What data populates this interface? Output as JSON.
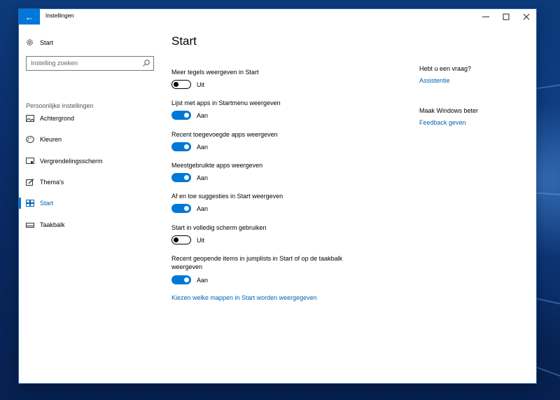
{
  "window": {
    "title": "Instellingen",
    "minimize_glyph": "—",
    "maximize_glyph": "☐",
    "close_glyph": "✕",
    "back_glyph": "←"
  },
  "sidebar": {
    "home_label": "Start",
    "search_placeholder": "Instelling zoeken",
    "section_label": "Persoonlijke instellingen",
    "items": [
      {
        "label": "Achtergrond",
        "icon": "picture-icon",
        "active": false
      },
      {
        "label": "Kleuren",
        "icon": "palette-icon",
        "active": false
      },
      {
        "label": "Vergrendelingsscherm",
        "icon": "lock-screen-icon",
        "active": false
      },
      {
        "label": "Thema's",
        "icon": "brush-icon",
        "active": false
      },
      {
        "label": "Start",
        "icon": "start-tiles-icon",
        "active": true
      },
      {
        "label": "Taakbalk",
        "icon": "taskbar-icon",
        "active": false
      }
    ]
  },
  "main": {
    "title": "Start",
    "settings": [
      {
        "label": "Meer tegels weergeven in Start",
        "on": false,
        "state": "Uit"
      },
      {
        "label": "Lijst met apps in Startmenu weergeven",
        "on": true,
        "state": "Aan"
      },
      {
        "label": "Recent toegevoegde apps weergeven",
        "on": true,
        "state": "Aan"
      },
      {
        "label": "Meestgebruikte apps weergeven",
        "on": true,
        "state": "Aan"
      },
      {
        "label": "Af en toe suggesties in Start weergeven",
        "on": true,
        "state": "Aan"
      },
      {
        "label": "Start in volledig scherm gebruiken",
        "on": false,
        "state": "Uit"
      },
      {
        "label": "Recent geopende items in jumplists in Start of op de taakbalk weergeven",
        "on": true,
        "state": "Aan"
      }
    ],
    "folders_link": "Kiezen welke mappen in Start worden weergegeven"
  },
  "aside": {
    "question_heading": "Hebt u een vraag?",
    "question_link": "Assistentie",
    "improve_heading": "Maak Windows beter",
    "improve_link": "Feedback geven"
  },
  "colors": {
    "accent": "#0078d7",
    "link": "#0063b1"
  }
}
